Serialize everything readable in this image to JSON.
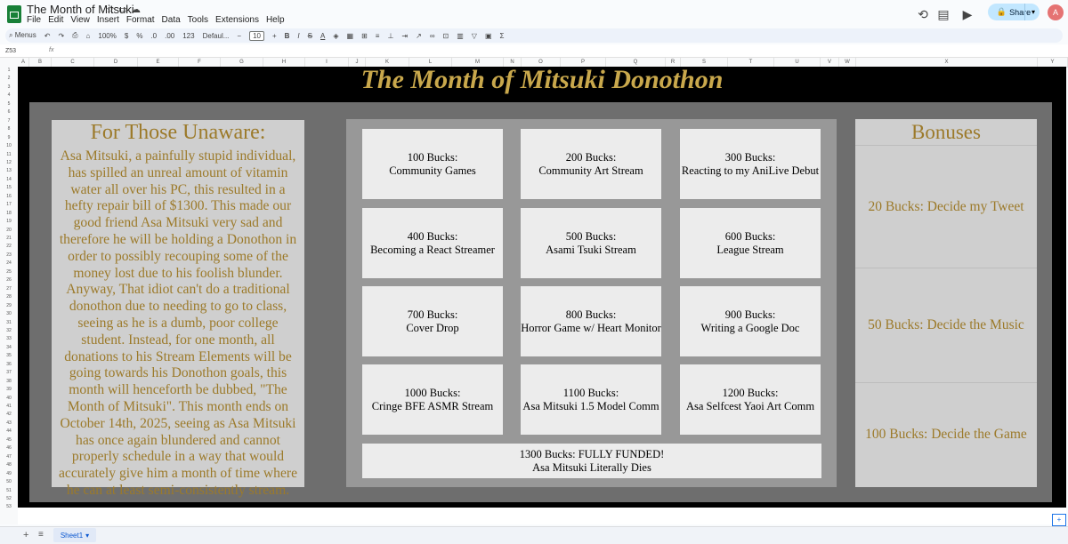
{
  "app": {
    "title": "The Month of Mitsuki",
    "menu": [
      "File",
      "Edit",
      "View",
      "Insert",
      "Format",
      "Data",
      "Tools",
      "Extensions",
      "Help"
    ],
    "share_label": "Share",
    "avatar_initial": "A"
  },
  "toolbar": {
    "search_label": "Menus",
    "zoom": "100%",
    "currency": "$",
    "percent": "%",
    "dec_decrease": ".0",
    "dec_increase": ".00",
    "number_format": "123",
    "font": "Defaul...",
    "font_size": "10"
  },
  "formula_bar": {
    "cell_ref": "Z53",
    "fx": "fx"
  },
  "columns": [
    "A",
    "B",
    "C",
    "D",
    "E",
    "F",
    "G",
    "H",
    "I",
    "J",
    "K",
    "L",
    "M",
    "N",
    "O",
    "P",
    "Q",
    "R",
    "S",
    "T",
    "U",
    "V",
    "W",
    "X",
    "Y"
  ],
  "rows_count": 53,
  "sheet": {
    "title": "The Month of Mitsuki Donothon",
    "left_heading": "For Those Unaware:",
    "left_body": "Asa Mitsuki, a painfully stupid individual, has spilled an unreal amount of vitamin water all over his PC, this resulted in a hefty repair bill of $1300. This made our good friend Asa Mitsuki very sad and therefore he will be holding a Donothon in order to possibly recouping some of the money lost due to his foolish blunder. Anyway, That idiot can't do a traditional donothon due to needing to go to class, seeing as he is a dumb, poor college student. Instead, for one month, all donations to his Stream Elements will be going towards his Donothon goals, this month will henceforth be dubbed, \"The Month of Mitsuki\". This month ends on October 14th, 2025, seeing as Asa Mitsuki has once again blundered and cannot properly schedule in a way that would accurately give him a month of time where he can at least semi-consistently stream.",
    "goals": [
      {
        "amount": "100 Bucks:",
        "name": "Community Games"
      },
      {
        "amount": "200 Bucks:",
        "name": "Community Art Stream"
      },
      {
        "amount": "300 Bucks:",
        "name": "Reacting to my AniLive Debut"
      },
      {
        "amount": "400 Bucks:",
        "name": "Becoming a React Streamer"
      },
      {
        "amount": "500 Bucks:",
        "name": "Asami Tsuki Stream"
      },
      {
        "amount": "600 Bucks:",
        "name": "League Stream"
      },
      {
        "amount": "700 Bucks:",
        "name": "Cover Drop"
      },
      {
        "amount": "800 Bucks:",
        "name": "Horror Game w/ Heart Monitor"
      },
      {
        "amount": "900 Bucks:",
        "name": "Writing a Google Doc"
      },
      {
        "amount": "1000 Bucks:",
        "name": "Cringe BFE ASMR Stream"
      },
      {
        "amount": "1100 Bucks:",
        "name": "Asa Mitsuki 1.5 Model Comm"
      },
      {
        "amount": "1200 Bucks:",
        "name": "Asa Selfcest Yaoi Art Comm"
      }
    ],
    "final_goal": {
      "amount": "1300 Bucks: FULLY FUNDED!",
      "name": "Asa Mitsuki Literally Dies"
    },
    "bonus_heading": "Bonuses",
    "bonuses": [
      "20 Bucks: Decide my Tweet",
      "50 Bucks: Decide the Music",
      "100 Bucks: Decide the Game"
    ]
  },
  "bottom": {
    "sheet_tab": "Sheet1"
  },
  "colors": {
    "title_gold": "#c9a84c",
    "text_gold": "#9c7a2a",
    "panel_gray": "#6e6e6e",
    "card_bg": "#ececec"
  }
}
